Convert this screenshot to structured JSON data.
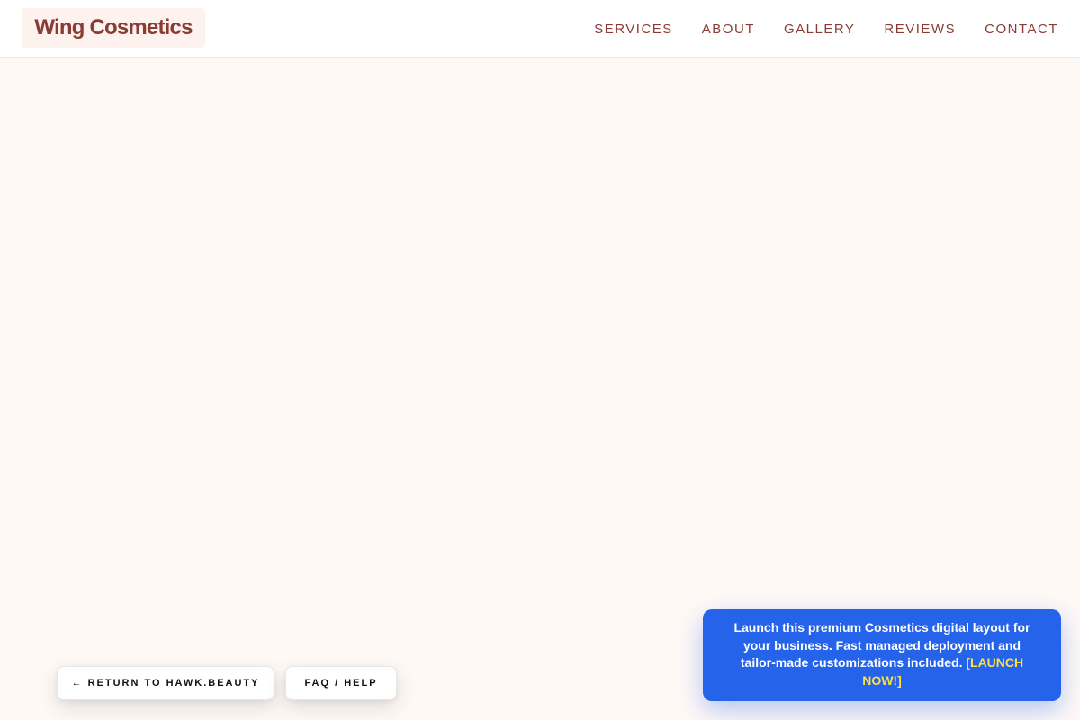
{
  "header": {
    "brand": "Wing Cosmetics",
    "nav": [
      {
        "label": "SERVICES"
      },
      {
        "label": "ABOUT"
      },
      {
        "label": "GALLERY"
      },
      {
        "label": "REVIEWS"
      },
      {
        "label": "CONTACT"
      }
    ]
  },
  "footer_buttons": {
    "return_label": "← RETURN TO HAWK.BEAUTY",
    "faq_label": "FAQ / HELP"
  },
  "promo": {
    "text": "Launch this premium Cosmetics digital layout for your business. Fast managed deployment and tailor-made customizations included.",
    "cta": "[LAUNCH NOW!]"
  },
  "colors": {
    "page_background": "#fff9f6",
    "brand": "#8a3b34",
    "promo_background": "#2563eb",
    "promo_cta": "#fde047"
  }
}
